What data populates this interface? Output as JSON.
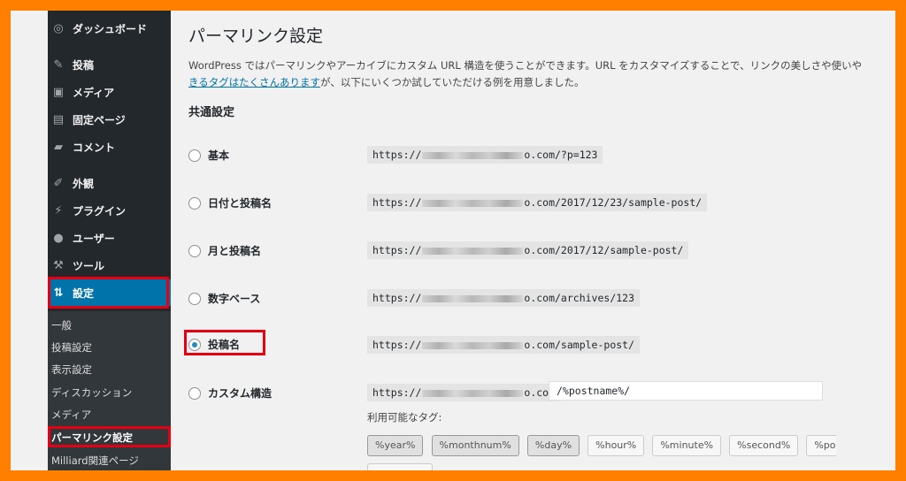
{
  "sidebar": {
    "items": [
      {
        "label": "ダッシュボード",
        "icon": "dashboard-icon",
        "glyph": "◎"
      },
      {
        "label": "投稿",
        "icon": "pin-icon",
        "glyph": "✎"
      },
      {
        "label": "メディア",
        "icon": "media-icon",
        "glyph": "▣"
      },
      {
        "label": "固定ページ",
        "icon": "page-icon",
        "glyph": "▤"
      },
      {
        "label": "コメント",
        "icon": "comment-icon",
        "glyph": "▰"
      },
      {
        "label": "外観",
        "icon": "appearance-icon",
        "glyph": "✐"
      },
      {
        "label": "プラグイン",
        "icon": "plugin-icon",
        "glyph": "⚡"
      },
      {
        "label": "ユーザー",
        "icon": "user-icon",
        "glyph": "●"
      },
      {
        "label": "ツール",
        "icon": "tools-icon",
        "glyph": "⚒"
      },
      {
        "label": "設定",
        "icon": "settings-icon",
        "glyph": "⇅"
      }
    ],
    "submenu": [
      "一般",
      "投稿設定",
      "表示設定",
      "ディスカッション",
      "メディア",
      "パーマリンク設定",
      "Milliard関連ページ"
    ]
  },
  "main": {
    "title": "パーマリンク設定",
    "intro_line1": "WordPress ではパーマリンクやアーカイブにカスタム URL 構造を使うことができます。URL をカスタマイズすることで、リンクの美しさや使いや",
    "intro_link": "きるタグはたくさんあります",
    "intro_line2_rest": "が、以下にいくつか試していただける例を用意しました。",
    "section_title": "共通設定",
    "options": [
      {
        "label": "基本",
        "prefix": "https://",
        "suffix": "o.com/?p=123"
      },
      {
        "label": "日付と投稿名",
        "prefix": "https://",
        "suffix": "o.com/2017/12/23/sample-post/"
      },
      {
        "label": "月と投稿名",
        "prefix": "https://",
        "suffix": "o.com/2017/12/sample-post/"
      },
      {
        "label": "数字ベース",
        "prefix": "https://",
        "suffix": "o.com/archives/123"
      },
      {
        "label": "投稿名",
        "prefix": "https://",
        "suffix": "o.com/sample-post/"
      },
      {
        "label": "カスタム構造",
        "prefix": "https://",
        "suffix": "o.com"
      }
    ],
    "custom_value": "/%postname%/",
    "tags_label": "利用可能なタグ:",
    "tags": [
      "%year%",
      "%monthnum%",
      "%day%",
      "%hour%",
      "%minute%",
      "%second%",
      "%post_id%"
    ]
  }
}
